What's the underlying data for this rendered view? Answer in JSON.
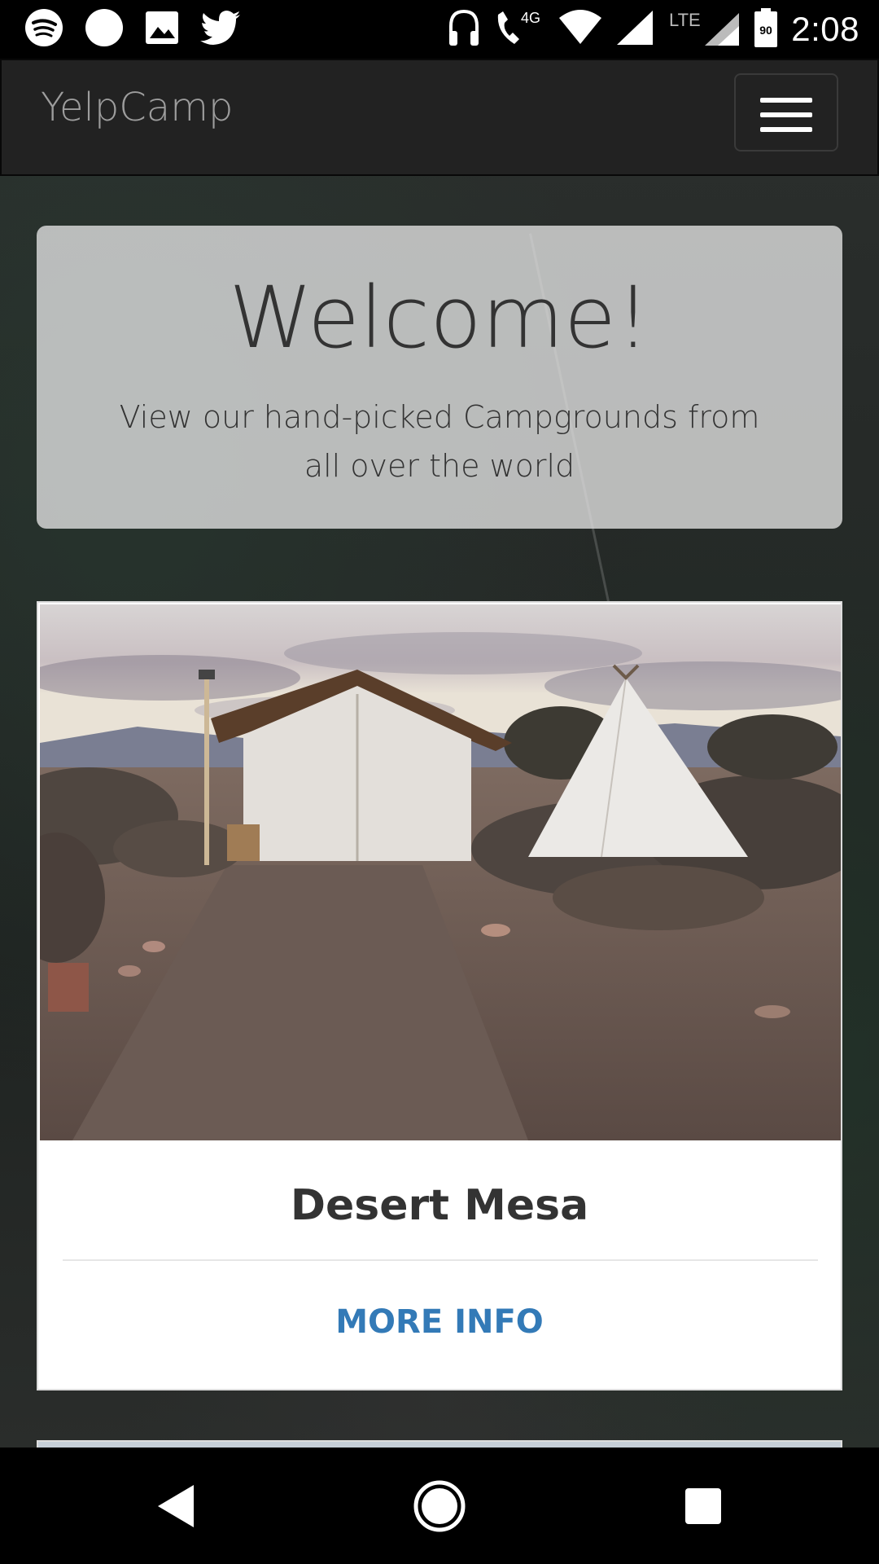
{
  "status_bar": {
    "time": "2:08",
    "network_label": "4G",
    "carrier_label": "LTE",
    "battery_level": "90",
    "left_icons": [
      "spotify-icon",
      "circle-notification-icon",
      "image-icon",
      "twitter-icon"
    ],
    "right_icons": [
      "headphones-icon",
      "wifi-call-icon",
      "wifi-icon",
      "signal-icon",
      "signal-icon",
      "battery-icon"
    ]
  },
  "navbar": {
    "brand": "YelpCamp",
    "menu_icon": "hamburger-menu-icon"
  },
  "jumbotron": {
    "title": "Welcome!",
    "subtitle": "View our hand-picked Campgrounds from all over the world"
  },
  "campgrounds": [
    {
      "name": "Desert Mesa",
      "link_label": "MORE INFO"
    }
  ],
  "colors": {
    "navbar_bg": "#222222",
    "brand_text": "#9d9d9d",
    "link": "#337ab7",
    "title_text": "#333333"
  },
  "system_nav": {
    "back_icon": "back-triangle-icon",
    "home_icon": "home-circle-icon",
    "recents_icon": "recents-square-icon"
  }
}
